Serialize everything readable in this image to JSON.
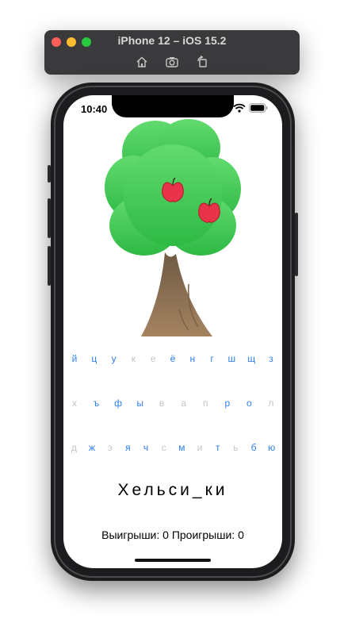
{
  "simulator": {
    "title": "iPhone 12 – iOS 15.2",
    "tools": [
      "home-icon",
      "screenshot-icon",
      "rotate-icon"
    ]
  },
  "status_bar": {
    "time": "10:40"
  },
  "keyboard": {
    "rows": [
      [
        {
          "letter": "й",
          "used": false
        },
        {
          "letter": "ц",
          "used": false
        },
        {
          "letter": "у",
          "used": false
        },
        {
          "letter": "к",
          "used": true
        },
        {
          "letter": "е",
          "used": true
        },
        {
          "letter": "ё",
          "used": false
        },
        {
          "letter": "н",
          "used": false
        },
        {
          "letter": "г",
          "used": false
        },
        {
          "letter": "ш",
          "used": false
        },
        {
          "letter": "щ",
          "used": false
        },
        {
          "letter": "з",
          "used": false
        }
      ],
      [
        {
          "letter": "х",
          "used": true
        },
        {
          "letter": "ъ",
          "used": false
        },
        {
          "letter": "ф",
          "used": false
        },
        {
          "letter": "ы",
          "used": false
        },
        {
          "letter": "в",
          "used": true
        },
        {
          "letter": "а",
          "used": true
        },
        {
          "letter": "п",
          "used": true
        },
        {
          "letter": "р",
          "used": false
        },
        {
          "letter": "о",
          "used": false
        },
        {
          "letter": "л",
          "used": true
        }
      ],
      [
        {
          "letter": "д",
          "used": true
        },
        {
          "letter": "ж",
          "used": false
        },
        {
          "letter": "э",
          "used": true
        },
        {
          "letter": "я",
          "used": false
        },
        {
          "letter": "ч",
          "used": false
        },
        {
          "letter": "с",
          "used": true
        },
        {
          "letter": "м",
          "used": false
        },
        {
          "letter": "и",
          "used": true
        },
        {
          "letter": "т",
          "used": false
        },
        {
          "letter": "ь",
          "used": true
        },
        {
          "letter": "б",
          "used": false
        },
        {
          "letter": "ю",
          "used": false
        }
      ]
    ]
  },
  "game": {
    "word": "Хельси_ки",
    "score_text": "Выигрыши: 0 Проигрыши: 0"
  },
  "colors": {
    "key_active": "#2f80ed",
    "key_used": "#c5c5c7",
    "leaf_top": "#5fd96b",
    "leaf_bottom": "#30b945",
    "trunk": "#9c7b57",
    "apple": "#e8334a"
  }
}
